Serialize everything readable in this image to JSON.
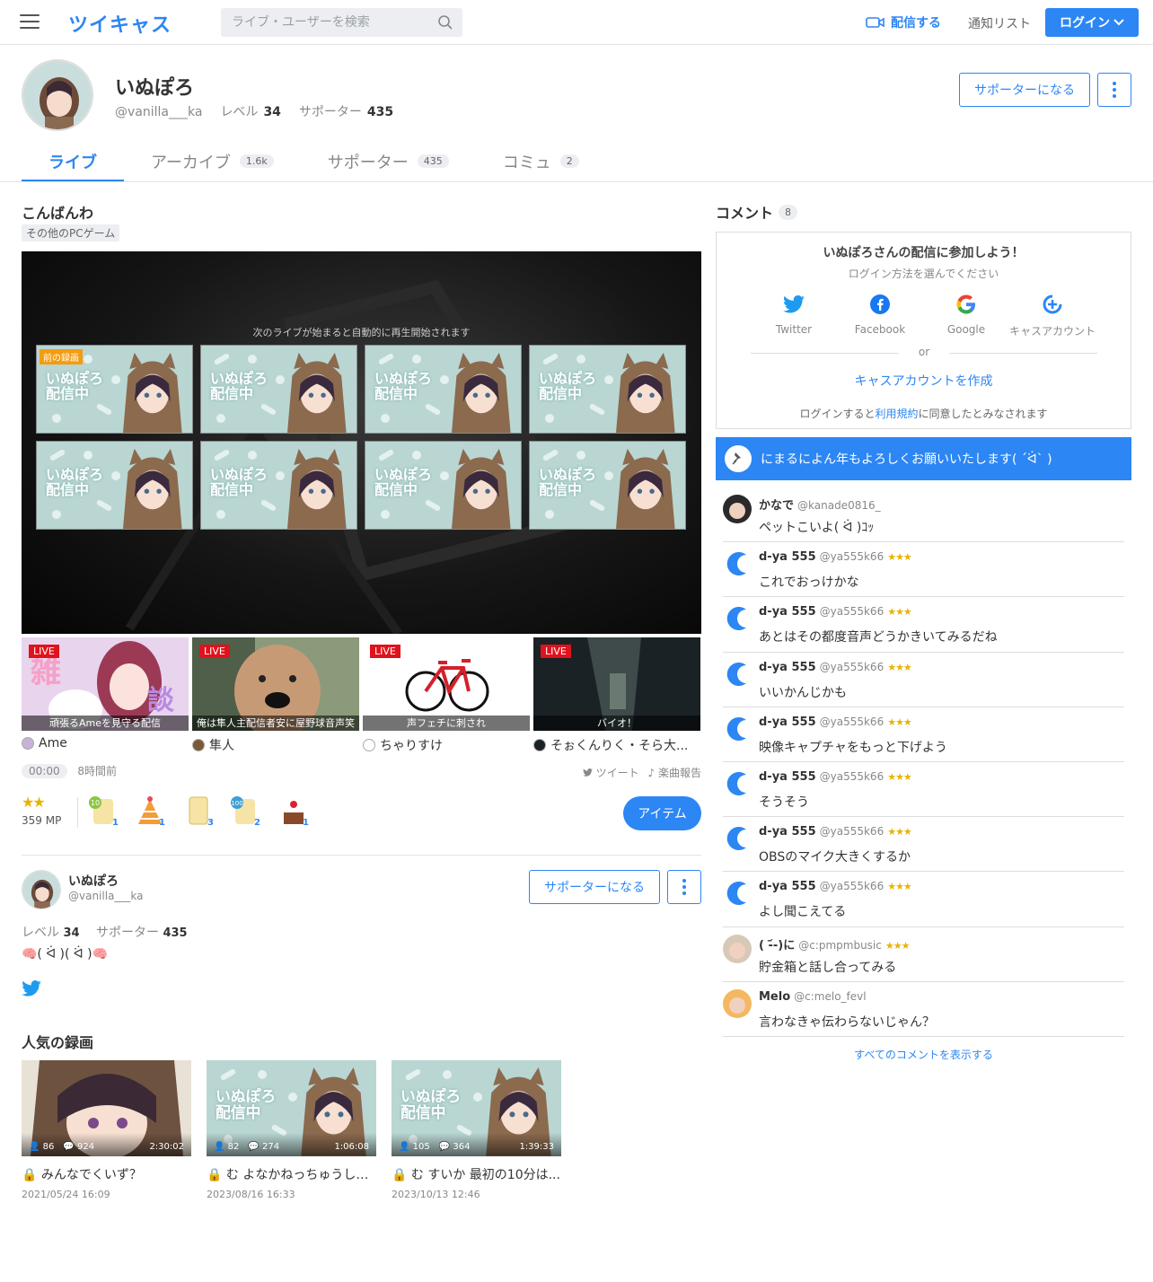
{
  "header": {
    "logo": "ツイキャス",
    "search_placeholder": "ライブ・ユーザーを検索",
    "broadcast": "配信する",
    "notifications": "通知リスト",
    "login": "ログイン"
  },
  "profile": {
    "name": "いぬぽろ",
    "handle": "@vanilla___ka",
    "level_label": "レベル",
    "level": "34",
    "supporter_label": "サポーター",
    "supporters": "435",
    "become_supporter": "サポーターになる"
  },
  "tabs": [
    {
      "label": "ライブ",
      "count": ""
    },
    {
      "label": "アーカイブ",
      "count": "1.6k"
    },
    {
      "label": "サポーター",
      "count": "435"
    },
    {
      "label": "コミュ",
      "count": "2"
    }
  ],
  "live": {
    "title": "こんばんわ",
    "category": "その他のPCゲーム",
    "player_message": "次のライブが始まると自動的に再生開始されます",
    "prev_badge": "前の録画",
    "thumb_text": "いぬぽろ配信中",
    "elapsed": "00:00",
    "ago": "8時間前",
    "tweet": "ツイート",
    "music_report": "楽曲報告",
    "mp": "359 MP",
    "item_button": "アイテム"
  },
  "gifts": [
    {
      "name": "tea-10",
      "count": "1"
    },
    {
      "name": "party-hat",
      "count": "1"
    },
    {
      "name": "star-card",
      "count": "3"
    },
    {
      "name": "tea-100",
      "count": "2"
    },
    {
      "name": "cake",
      "count": "1"
    }
  ],
  "live_strip": [
    {
      "badge": "LIVE",
      "caption": "頑張るAmeを見守る配信",
      "user": "Ame",
      "color": "#c7b3d6"
    },
    {
      "badge": "LIVE",
      "caption": "俺は隼人主配信者安に屋野球音声笑",
      "user": "隼人",
      "color": "#7a5a3a"
    },
    {
      "badge": "LIVE",
      "caption": "声フェチに刺され",
      "user": "ちゃりすけ",
      "color": "#ffffff"
    },
    {
      "badge": "LIVE",
      "caption": "バイオ！",
      "user": "そぉくんりく・そら大...",
      "color": "#1a2226"
    }
  ],
  "user_card": {
    "name": "いぬぽろ",
    "handle": "@vanilla___ka",
    "level_label": "レベル",
    "level": "34",
    "supporter_label": "サポーター",
    "supporters": "435",
    "bio": "🧠( ᐛ )( ᐛ )🧠",
    "become_supporter": "サポーターになる"
  },
  "popular": {
    "title": "人気の録画",
    "items": [
      {
        "viewers": "86",
        "comments": "924",
        "duration": "2:30:02",
        "title": "みんなでくいず？",
        "date": "2021/05/24 16:09"
      },
      {
        "viewers": "82",
        "comments": "274",
        "duration": "1:06:08",
        "title": "む よなかねっちゅうしょ...",
        "date": "2023/08/16 16:33"
      },
      {
        "viewers": "105",
        "comments": "364",
        "duration": "1:39:33",
        "title": "む すいか 最初の10分は...",
        "date": "2023/10/13 12:46"
      }
    ]
  },
  "comments_panel": {
    "title": "コメント",
    "count": "8",
    "login_title": "いぬぽろさんの配信に参加しよう！",
    "login_sub": "ログイン方法を選んでください",
    "providers": [
      "Twitter",
      "Facebook",
      "Google",
      "キャスアカウント"
    ],
    "or": "or",
    "create": "キャスアカウントを作成",
    "terms_prefix": "ログインすると",
    "terms_link": "利用規約",
    "terms_suffix": "に同意したとみなされます",
    "pinned": "にまるによん年もよろしくお願いいたします( ´ᐛ` )",
    "show_all": "すべてのコメントを表示する"
  },
  "comments": [
    {
      "name": "かなで",
      "id": "@kanade0816_",
      "stars": "",
      "text": "ペットこいよ( ᐛ )ｺｯ"
    },
    {
      "name": "d-ya 555",
      "id": "@ya555k66",
      "stars": "★★★",
      "text": "これでおっけかな"
    },
    {
      "name": "d-ya 555",
      "id": "@ya555k66",
      "stars": "★★★",
      "text": "あとはその都度音声どうかきいてみるだね"
    },
    {
      "name": "d-ya 555",
      "id": "@ya555k66",
      "stars": "★★★",
      "text": "いいかんじかも"
    },
    {
      "name": "d-ya 555",
      "id": "@ya555k66",
      "stars": "★★★",
      "text": "映像キャプチャをもっと下げよう"
    },
    {
      "name": "d-ya 555",
      "id": "@ya555k66",
      "stars": "★★★",
      "text": "そうそう"
    },
    {
      "name": "d-ya 555",
      "id": "@ya555k66",
      "stars": "★★★",
      "text": "OBSのマイク大きくするか"
    },
    {
      "name": "d-ya 555",
      "id": "@ya555k66",
      "stars": "★★★",
      "text": "よし聞こえてる"
    },
    {
      "name": "( -᷄-)に",
      "id": "@c:pmpmbusic",
      "stars": "★★★",
      "text": "貯金箱と話し合ってみる"
    },
    {
      "name": "Melo",
      "id": "@c:melo_fevl",
      "stars": "",
      "text": "言わなきゃ伝わらないじゃん？"
    }
  ],
  "colors": {
    "accent": "#2c86f4",
    "live": "#e0121c",
    "star": "#e8b400"
  }
}
